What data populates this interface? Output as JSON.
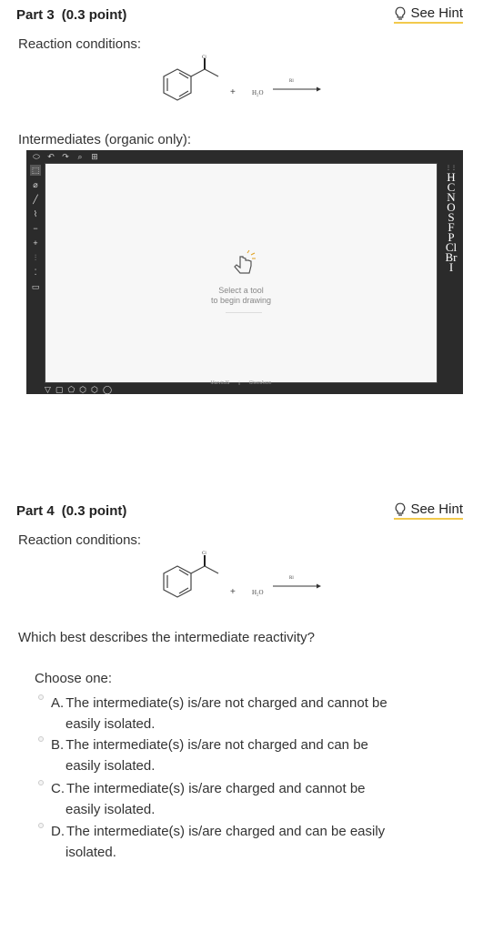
{
  "part3": {
    "title": "Part 3",
    "points": "(0.3 point)",
    "hint": "See Hint",
    "conditions_label": "Reaction conditions:",
    "reaction": {
      "reagent": "H₂O",
      "arrow_label": "Rl",
      "plus": "+",
      "substituent": "Cl"
    },
    "intermediates_label": "Intermediates (organic only):"
  },
  "editor": {
    "canvas_message_line1": "Select a tool",
    "canvas_message_line2": "to begin drawing",
    "credit1": "MarvinJS",
    "credit2": "ChemAxon",
    "elements": [
      "H",
      "C",
      "N",
      "O",
      "S",
      "F",
      "P",
      "Cl",
      "Br",
      "I"
    ]
  },
  "part4": {
    "title": "Part 4",
    "points": "(0.3 point)",
    "hint": "See Hint",
    "conditions_label": "Reaction conditions:",
    "reaction": {
      "reagent": "H₂O",
      "arrow_label": "Rl",
      "plus": "+",
      "substituent": "Cl"
    },
    "question": "Which best describes the intermediate reactivity?",
    "choose": "Choose one:",
    "options": [
      {
        "letter": "A.",
        "line1": "The intermediate(s) is/are not charged and cannot be",
        "line2": "easily isolated."
      },
      {
        "letter": "B.",
        "line1": "The intermediate(s) is/are not charged and can be",
        "line2": "easily isolated."
      },
      {
        "letter": "C.",
        "line1": "The intermediate(s) is/are charged and cannot be",
        "line2": "easily isolated."
      },
      {
        "letter": "D.",
        "line1": "The intermediate(s) is/are charged and can be easily",
        "line2": "isolated."
      }
    ]
  },
  "colors": {
    "hint_underline": "#f2c94c",
    "editor_bg": "#2b2b2b",
    "canvas_bg": "#f7f7f7"
  }
}
